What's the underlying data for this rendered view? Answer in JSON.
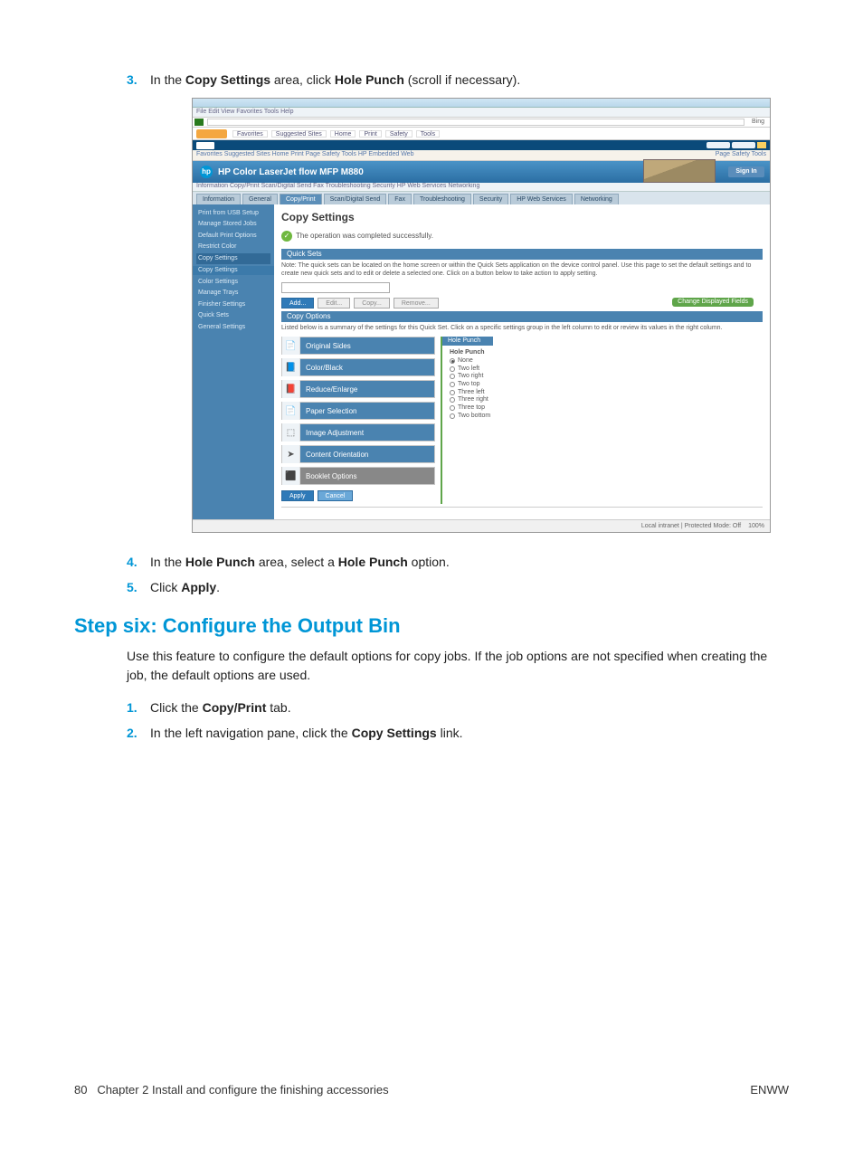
{
  "step3": {
    "num": "3.",
    "pre": "In the ",
    "b1": "Copy Settings",
    "mid": " area, click ",
    "b2": "Hole Punch",
    "post": " (scroll if necessary)."
  },
  "step4": {
    "num": "4.",
    "pre": "In the ",
    "b1": "Hole Punch",
    "mid": " area, select a ",
    "b2": "Hole Punch",
    "post": " option."
  },
  "step5": {
    "num": "5.",
    "pre": "Click ",
    "b1": "Apply",
    "post": "."
  },
  "heading": "Step six: Configure the Output Bin",
  "para": "Use this feature to configure the default options for copy jobs. If the job options are not specified when creating the job, the default options are used.",
  "sub1": {
    "num": "1.",
    "pre": "Click the ",
    "b1": "Copy/Print",
    "post": " tab."
  },
  "sub2": {
    "num": "2.",
    "pre": "In the left navigation pane, click the ",
    "b1": "Copy Settings",
    "post": " link."
  },
  "footer": {
    "left_page": "80",
    "left_text": "Chapter 2   Install and configure the finishing accessories",
    "right": "ENWW"
  },
  "shot": {
    "menubar": "File  Edit  View  Favorites  Tools  Help",
    "addr_right": "Bing",
    "favbar_items": [
      "Favorites",
      "Suggested Sites",
      "Home",
      "Print",
      "Safety",
      "Tools"
    ],
    "toolrow_left": "Favorites    Suggested Sites    Home    Print    Page    Safety    Tools    HP Embedded Web",
    "toolrow_right": "Page  Safety  Tools",
    "hp_title": "HP Color LaserJet flow MFP M880",
    "signin": "Sign In",
    "subline": "Information  Copy/Print  Scan/Digital Send  Fax  Troubleshooting  Security  HP Web Services  Networking",
    "tabs": [
      "Information",
      "General",
      "Copy/Print",
      "Scan/Digital Send",
      "Fax",
      "Troubleshooting",
      "Security",
      "HP Web Services",
      "Networking"
    ],
    "side_items": [
      "Print from USB Setup",
      "Manage Stored Jobs",
      "Default Print Options",
      "Restrict Color",
      "Copy Settings",
      "Color Settings",
      "Manage Trays",
      "Finisher Settings",
      "Quick Sets",
      "General Settings"
    ],
    "side_sub": "Copy Settings",
    "cs_head": "Copy Settings",
    "success": "The operation was completed successfully.",
    "bar_intro": "Quick Sets",
    "note1": "Note: The quick sets can be located on the home screen or within the Quick Sets application on the device control panel. Use this page to set the default settings and to create new quick sets and to edit or delete a selected one. Click on a button below to take action to apply setting.",
    "btn_add": "Add...",
    "btn_edit": "Edit...",
    "btn_copy": "Copy...",
    "btn_remove": "Remove...",
    "pill": "Change Displayed Fields",
    "bar_options": "Copy Options",
    "note2": "Listed below is a summary of the settings for this Quick Set. Click on a specific settings group in the left column to edit or review its values in the right column.",
    "cards": [
      {
        "icon": "📄",
        "label": "Original Sides"
      },
      {
        "icon": "📘",
        "label": "Color/Black"
      },
      {
        "icon": "📕",
        "label": "Reduce/Enlarge"
      },
      {
        "icon": "📄",
        "label": "Paper Selection"
      },
      {
        "icon": "⬚",
        "label": "Image Adjustment"
      },
      {
        "icon": "➤",
        "label": "Content Orientation"
      },
      {
        "icon": "⬛",
        "label": "Booklet Options"
      }
    ],
    "right_head": "Hole Punch",
    "radios": [
      "Hole Punch",
      "None",
      "Two left",
      "Two right",
      "Two top",
      "Three left",
      "Three right",
      "Three top",
      "Two bottom"
    ],
    "apply": "Apply",
    "cancel": "Cancel",
    "status_right1": "Local intranet | Protected Mode: Off",
    "status_right2": "100%"
  }
}
